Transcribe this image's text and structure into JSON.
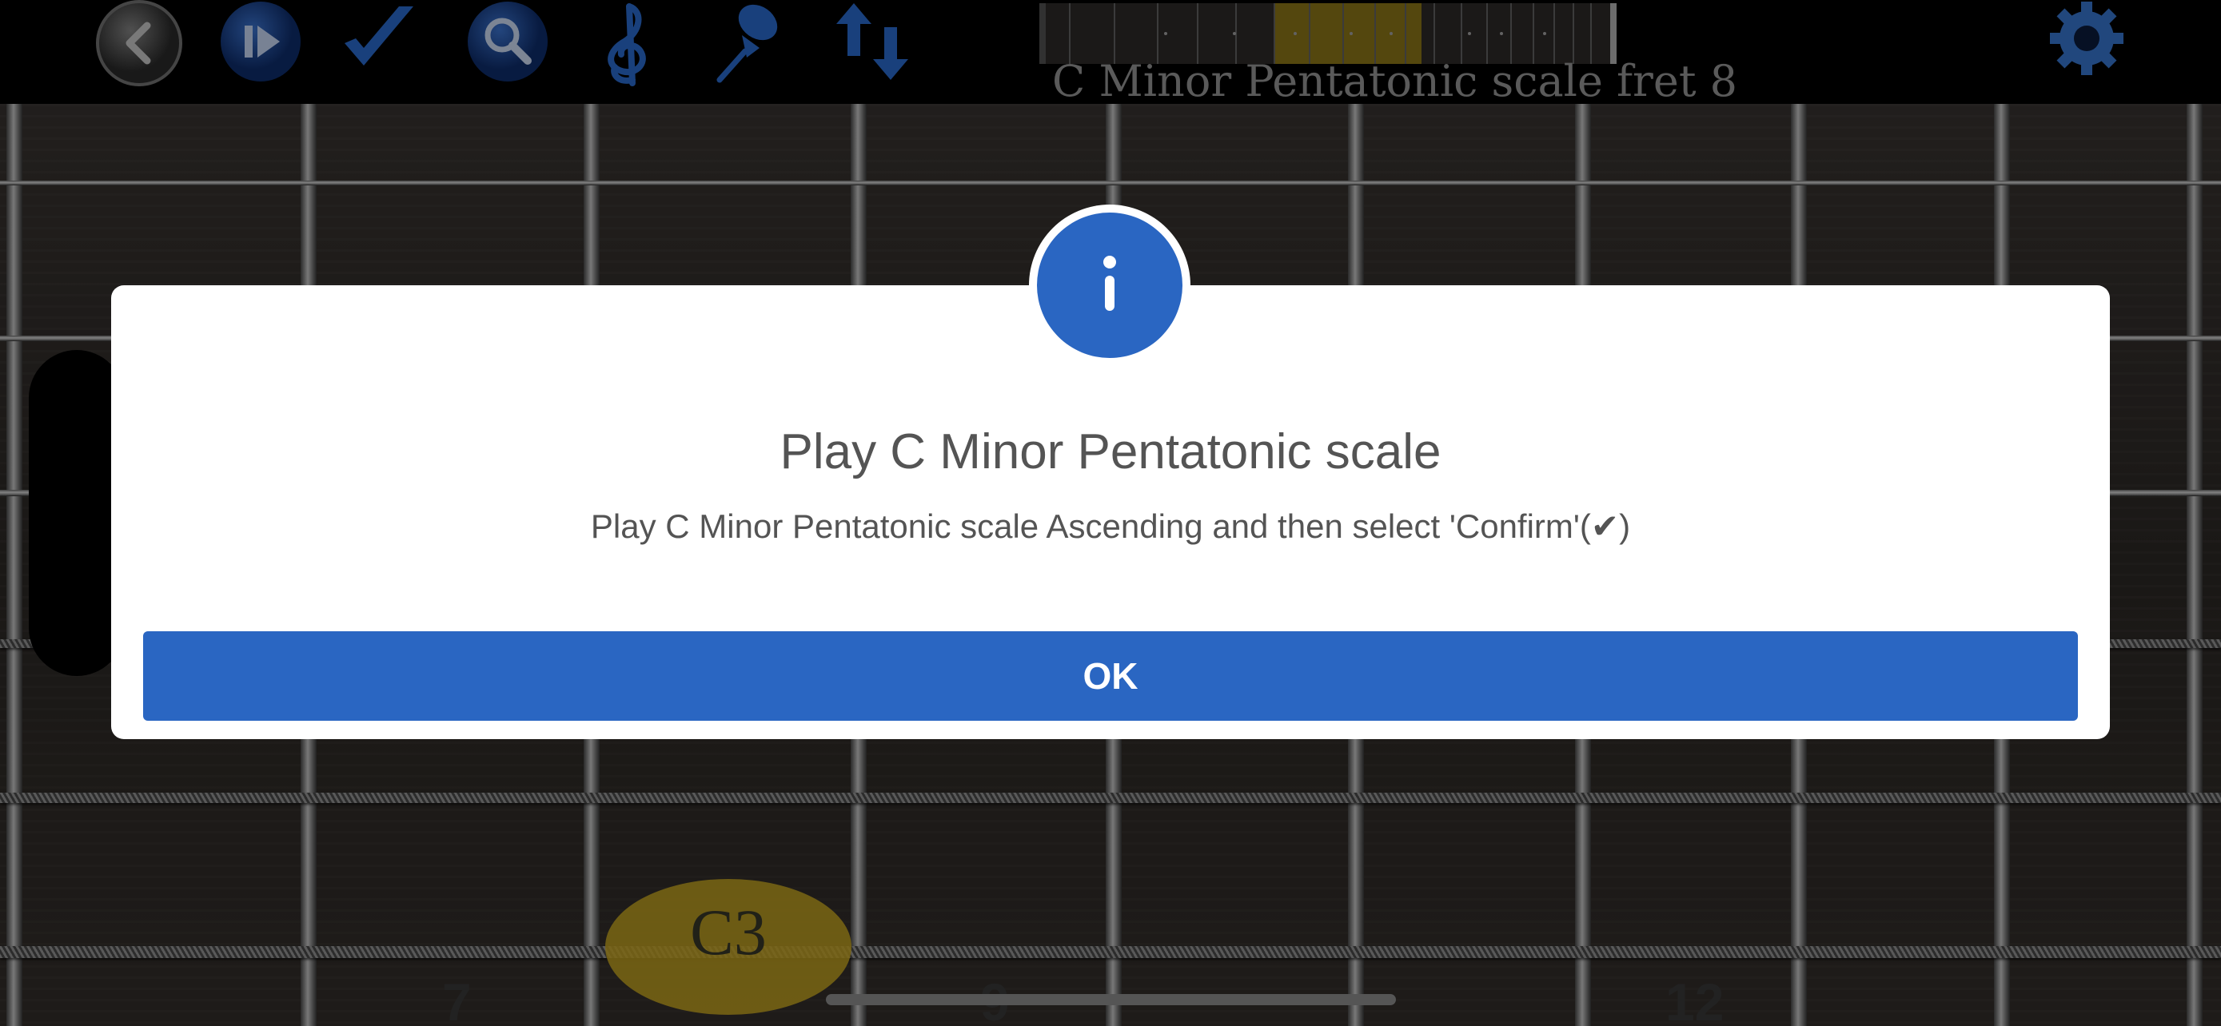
{
  "toolbar": {
    "scale_label": "C Minor Pentatonic scale fret 8"
  },
  "fretboard": {
    "fret_numbers": [
      "7",
      "9",
      "12"
    ],
    "highlighted_note": "C3"
  },
  "dialog": {
    "title": "Play C Minor Pentatonic scale",
    "message": "Play C Minor Pentatonic scale Ascending and then select 'Confirm'(✔)",
    "ok_label": "OK",
    "icon": "info-icon"
  },
  "colors": {
    "accent": "#2a66c2",
    "note_highlight": "#d4b022"
  }
}
